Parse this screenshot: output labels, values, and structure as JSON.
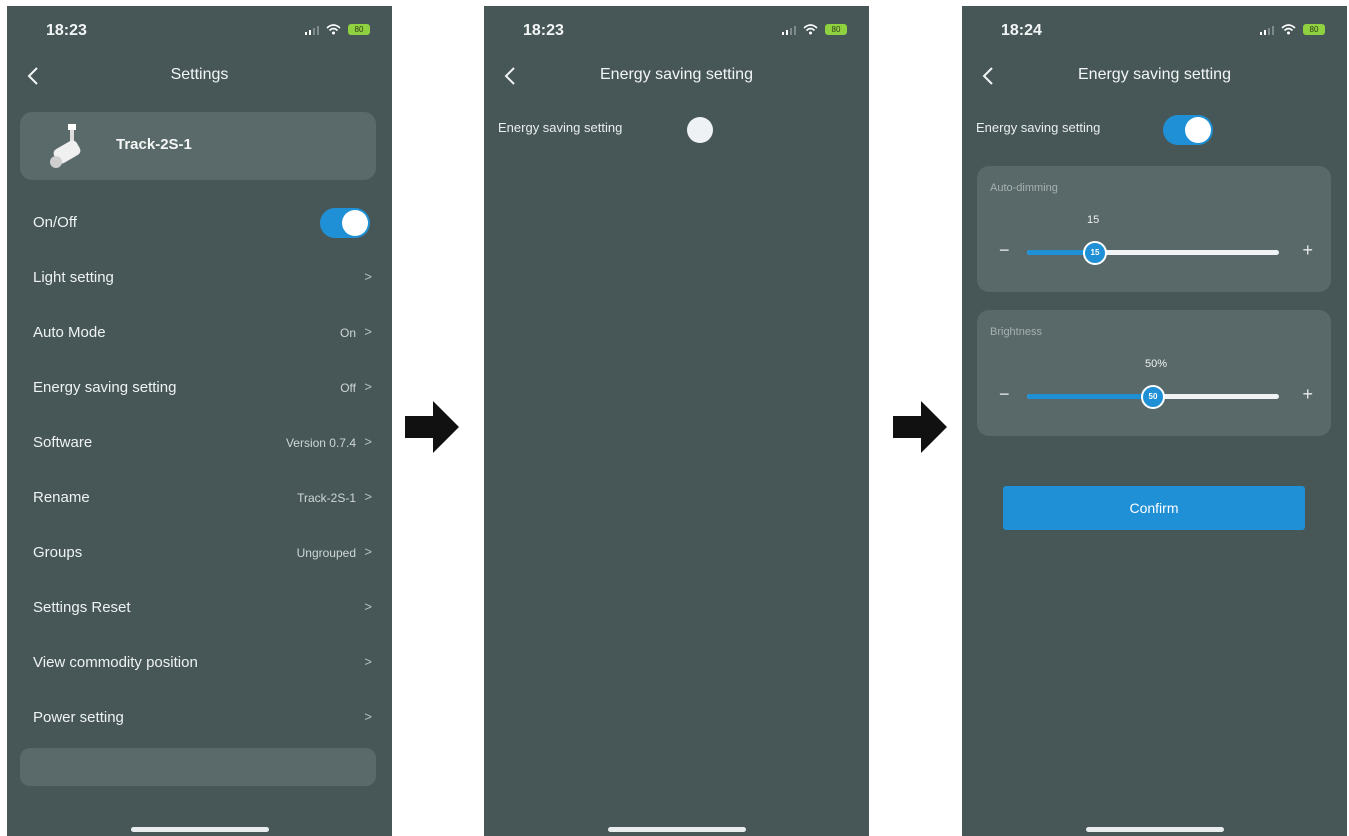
{
  "screens": [
    {
      "time": "18:23",
      "title": "Settings",
      "device_name": "Track-2S-1",
      "rows": [
        {
          "label": "On/Off",
          "value": "",
          "toggle": "on"
        },
        {
          "label": "Light setting",
          "value": "",
          "chevron": ">"
        },
        {
          "label": "Auto Mode",
          "value": "On",
          "chevron": ">"
        },
        {
          "label": "Energy saving setting",
          "value": "Off",
          "chevron": ">"
        },
        {
          "label": "Software",
          "value": "Version 0.7.4",
          "chevron": ">"
        },
        {
          "label": "Rename",
          "value": "Track-2S-1",
          "chevron": ">"
        },
        {
          "label": "Groups",
          "value": "Ungrouped",
          "chevron": ">"
        },
        {
          "label": "Settings Reset",
          "value": "",
          "chevron": ">"
        },
        {
          "label": "View commodity position",
          "value": "",
          "chevron": ">"
        },
        {
          "label": "Power setting",
          "value": "",
          "chevron": ">"
        }
      ]
    },
    {
      "time": "18:23",
      "title": "Energy saving setting",
      "setting_label": "Energy saving setting",
      "toggle": "off"
    },
    {
      "time": "18:24",
      "title": "Energy saving setting",
      "setting_label": "Energy saving setting",
      "toggle": "on",
      "auto_dimming": {
        "label": "Auto-dimming",
        "value": "15",
        "thumb_text": "15",
        "fraction": 0.27
      },
      "brightness": {
        "label": "Brightness",
        "value": "50%",
        "thumb_text": "50",
        "fraction": 0.5
      },
      "minus": "−",
      "plus": "+",
      "confirm_label": "Confirm"
    }
  ],
  "battery_text": "80",
  "colors": {
    "background": "#475757",
    "card": "#5a6969",
    "accent": "#1f8fd6",
    "battery": "#8fd13f"
  }
}
